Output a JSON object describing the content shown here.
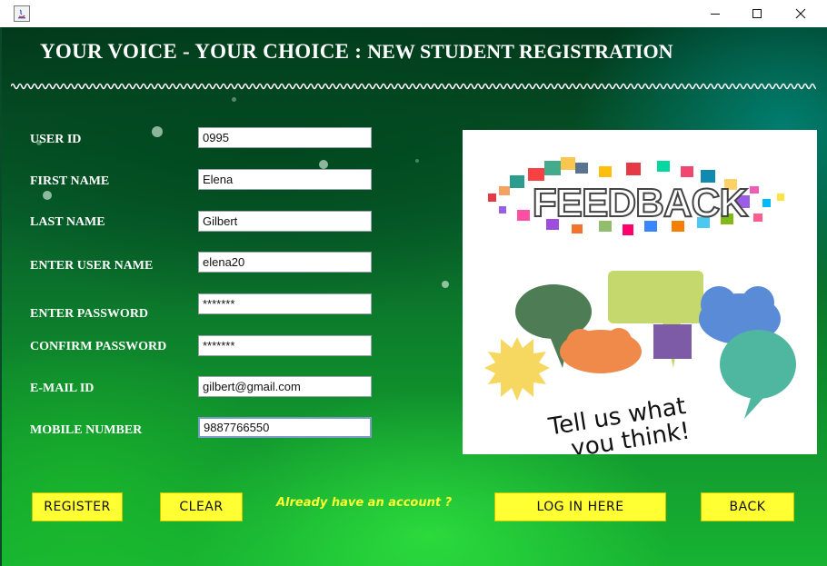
{
  "window": {
    "app_icon": "java-app-icon",
    "minimize_icon": "minimize-icon",
    "maximize_icon": "maximize-icon",
    "close_icon": "close-icon"
  },
  "header": {
    "title": "YOUR VOICE - YOUR CHOICE :",
    "subtitle": "NEW STUDENT REGISTRATION"
  },
  "form": {
    "fields": [
      {
        "label": "USER ID",
        "value": "0995"
      },
      {
        "label": "FIRST NAME",
        "value": "Elena"
      },
      {
        "label": "LAST NAME",
        "value": "Gilbert"
      },
      {
        "label": "ENTER USER NAME",
        "value": "elena20"
      },
      {
        "label": "ENTER PASSWORD",
        "value": "*******"
      },
      {
        "label": "CONFIRM PASSWORD",
        "value": "*******"
      },
      {
        "label": "E-MAIL ID",
        "value": "gilbert@gmail.com"
      },
      {
        "label": "MOBILE NUMBER",
        "value": "9887766550"
      }
    ]
  },
  "image": {
    "headline": "FEEDBACK",
    "caption_line1": "Tell us what",
    "caption_line2": "you think!"
  },
  "actions": {
    "register": "REGISTER",
    "clear": "CLEAR",
    "prompt": "Already have an account ?",
    "login": "LOG IN HERE",
    "back": "BACK"
  },
  "colors": {
    "button_bg": "#ffff33",
    "prompt_text": "#ffff33",
    "background_dark": "#02381c",
    "background_light": "#17b332"
  }
}
